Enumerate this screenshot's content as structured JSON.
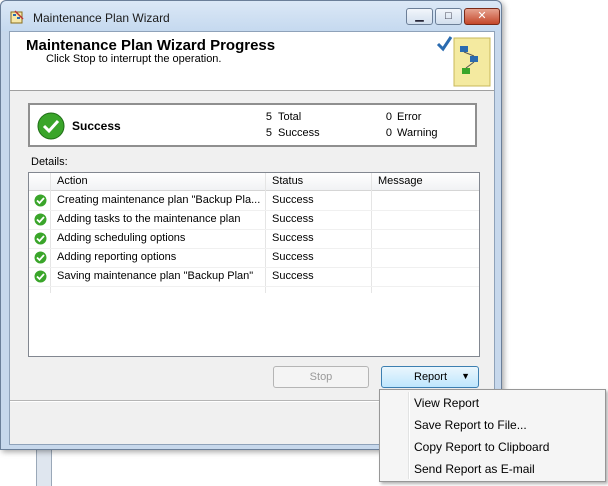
{
  "window": {
    "title": "Maintenance Plan Wizard"
  },
  "header": {
    "title": "Maintenance Plan Wizard Progress",
    "subtitle": "Click Stop to interrupt the operation."
  },
  "summary": {
    "status": "Success",
    "total_count": "5",
    "total_label": "Total",
    "success_count": "5",
    "success_label": "Success",
    "error_count": "0",
    "error_label": "Error",
    "warning_count": "0",
    "warning_label": "Warning"
  },
  "details": {
    "label": "Details:",
    "columns": [
      "Action",
      "Status",
      "Message"
    ],
    "rows": [
      {
        "action": "Creating maintenance plan \"Backup Pla...",
        "status": "Success",
        "message": ""
      },
      {
        "action": "Adding tasks to the maintenance plan",
        "status": "Success",
        "message": ""
      },
      {
        "action": "Adding scheduling options",
        "status": "Success",
        "message": ""
      },
      {
        "action": "Adding reporting options",
        "status": "Success",
        "message": ""
      },
      {
        "action": "Saving maintenance plan \"Backup Plan\"",
        "status": "Success",
        "message": ""
      }
    ]
  },
  "buttons": {
    "stop": "Stop",
    "report": "Report"
  },
  "report_menu": {
    "items": [
      "View Report",
      "Save Report to File...",
      "Copy Report to Clipboard",
      "Send Report as E-mail"
    ]
  },
  "colors": {
    "success_green": "#3aa52a",
    "accent_blue": "#3c7fb1"
  }
}
